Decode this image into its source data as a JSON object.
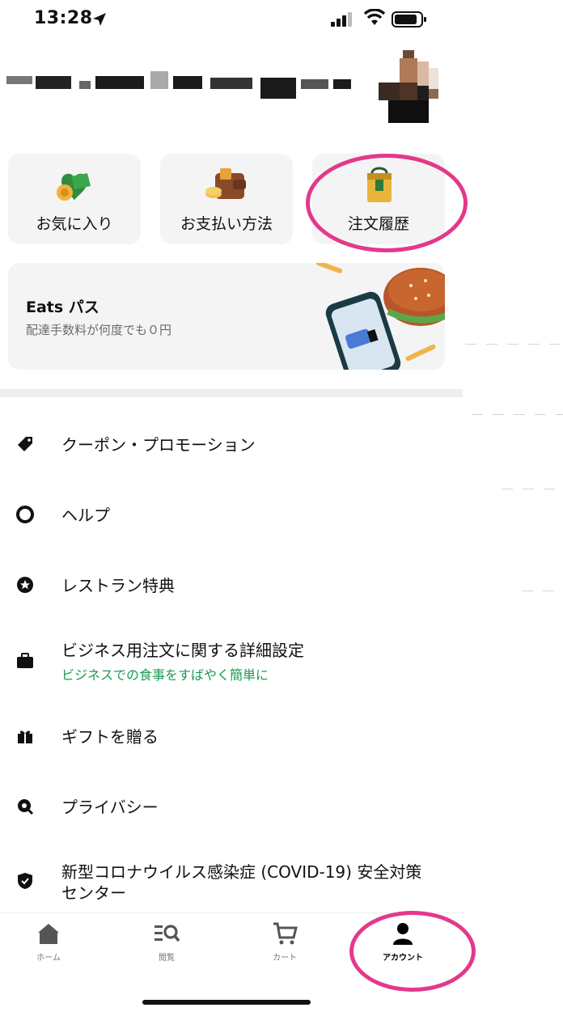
{
  "status_bar": {
    "time": "13:28"
  },
  "quick_actions": [
    {
      "label": "お気に入り",
      "icon": "favorites-icon"
    },
    {
      "label": "お支払い方法",
      "icon": "wallet-icon"
    },
    {
      "label": "注文履歴",
      "icon": "order-bag-icon",
      "highlighted": true
    }
  ],
  "eats_pass": {
    "title": "Eats パス",
    "subtitle": "配達手数料が何度でも０円"
  },
  "menu": [
    {
      "label": "クーポン・プロモーション",
      "icon": "tag-icon"
    },
    {
      "label": "ヘルプ",
      "icon": "lifebuoy-icon"
    },
    {
      "label": "レストラン特典",
      "icon": "star-badge-icon"
    },
    {
      "label": "ビジネス用注文に関する詳細設定",
      "sublabel": "ビジネスでの食事をすばやく簡単に",
      "icon": "briefcase-icon"
    },
    {
      "label": "ギフトを贈る",
      "icon": "gift-icon"
    },
    {
      "label": "プライバシー",
      "icon": "privacy-icon"
    },
    {
      "label": "新型コロナウイルス感染症 (COVID-19) 安全対策",
      "label2": "センター",
      "icon": "shield-icon"
    }
  ],
  "tabs": [
    {
      "label": "ホーム",
      "icon": "home-icon"
    },
    {
      "label": "閲覧",
      "icon": "browse-search-icon"
    },
    {
      "label": "カート",
      "icon": "cart-icon"
    },
    {
      "label": "アカウント",
      "icon": "account-icon",
      "active": true
    }
  ],
  "colors": {
    "highlight": "#e3398b",
    "accent_green": "#1a9b50",
    "tile_bg": "#f4f4f4"
  }
}
